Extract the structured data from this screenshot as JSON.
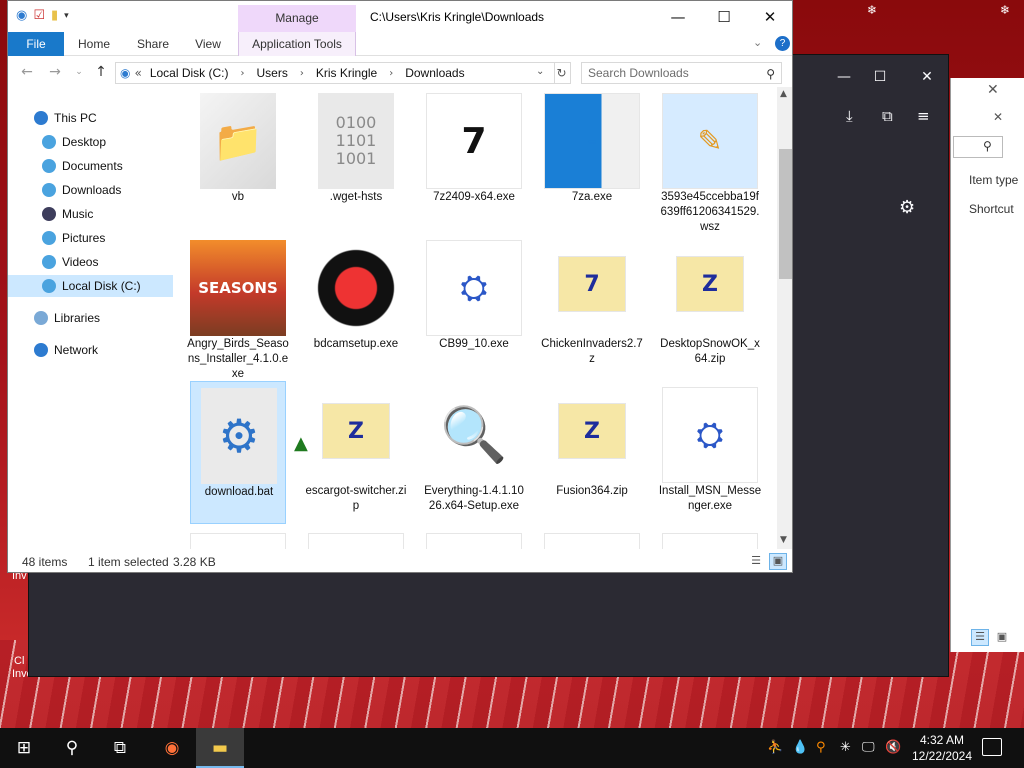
{
  "explorer": {
    "title_path": "C:\\Users\\Kris Kringle\\Downloads",
    "context_tab": "Manage",
    "ribbon_tabs": [
      "File",
      "Home",
      "Share",
      "View",
      "Application Tools"
    ],
    "breadcrumbs": [
      "Local Disk (C:)",
      "Users",
      "Kris Kringle",
      "Downloads"
    ],
    "breadcrumb_prefix": "«",
    "search_placeholder": "Search Downloads",
    "nav_items": [
      {
        "label": "This PC",
        "icon": "computer-icon",
        "color": "#2d7bd0",
        "indent": 1
      },
      {
        "label": "Desktop",
        "icon": "desktop-icon",
        "color": "#4aa3df",
        "indent": 2
      },
      {
        "label": "Documents",
        "icon": "documents-icon",
        "color": "#4aa3df",
        "indent": 2
      },
      {
        "label": "Downloads",
        "icon": "downloads-icon",
        "color": "#4aa3df",
        "indent": 2
      },
      {
        "label": "Music",
        "icon": "music-icon",
        "color": "#3d3d5c",
        "indent": 2
      },
      {
        "label": "Pictures",
        "icon": "pictures-icon",
        "color": "#4aa3df",
        "indent": 2
      },
      {
        "label": "Videos",
        "icon": "videos-icon",
        "color": "#4aa3df",
        "indent": 2
      },
      {
        "label": "Local Disk (C:)",
        "icon": "drive-icon",
        "color": "#4aa3df",
        "indent": 2,
        "selected": true
      },
      {
        "label": "Libraries",
        "icon": "libraries-icon",
        "color": "#7aa9d6",
        "indent": 1
      },
      {
        "label": "Network",
        "icon": "network-icon",
        "color": "#2d7bd0",
        "indent": 1
      }
    ],
    "files": [
      {
        "name": "vb",
        "icon": "folder-icon",
        "glyph": "📁"
      },
      {
        "name": ".wget-hsts",
        "icon": "binary-file-icon",
        "glyph": "0100\n1101\n1001"
      },
      {
        "name": "7z2409-x64.exe",
        "icon": "7zip-installer-icon",
        "glyph": "7"
      },
      {
        "name": "7za.exe",
        "icon": "window-app-icon",
        "glyph": "▭"
      },
      {
        "name": "3593e45ccebba19f639ff61206341529.wsz",
        "icon": "skin-file-icon",
        "glyph": "✎"
      },
      {
        "name": "Angry_Birds_Seasons_Installer_4.1.0.exe",
        "icon": "angry-birds-icon",
        "glyph": "SEASONS"
      },
      {
        "name": "bdcamsetup.exe",
        "icon": "bandicam-icon",
        "glyph": "●"
      },
      {
        "name": "CB99_10.exe",
        "icon": "installer-icon",
        "glyph": "⛭"
      },
      {
        "name": "ChickenInvaders2.7z",
        "icon": "7z-archive-icon",
        "glyph": "7"
      },
      {
        "name": "DesktopSnowOK_x64.zip",
        "icon": "zip-archive-icon",
        "glyph": "Z"
      },
      {
        "name": "download.bat",
        "icon": "batch-file-icon",
        "glyph": "⚙",
        "selected": true
      },
      {
        "name": "escargot-switcher.zip",
        "icon": "zip-archive-icon",
        "glyph": "Z"
      },
      {
        "name": "Everything-1.4.1.1026.x64-Setup.exe",
        "icon": "everything-search-icon",
        "glyph": "🔍"
      },
      {
        "name": "Fusion364.zip",
        "icon": "zip-archive-icon",
        "glyph": "Z"
      },
      {
        "name": "Install_MSN_Messenger.exe",
        "icon": "msn-installer-icon",
        "glyph": "⛭"
      }
    ],
    "status": {
      "item_count": "48 items",
      "selection": "1 item selected",
      "size": "3.28 KB"
    }
  },
  "background_window": {
    "column_item_type": "Item type",
    "column_shortcut": "Shortcut"
  },
  "desktop_peek": {
    "left_text": "Inv",
    "left_text2": "Cl",
    "left_text3": "Invec..."
  },
  "taskbar": {
    "time": "4:32 AM",
    "date": "12/22/2024"
  },
  "colors": {
    "accent": "#1979ca",
    "selection": "#cce8ff",
    "manage": "#efd8fa",
    "desktop_red": "#a3121a",
    "dark_window": "#2b2a33"
  }
}
